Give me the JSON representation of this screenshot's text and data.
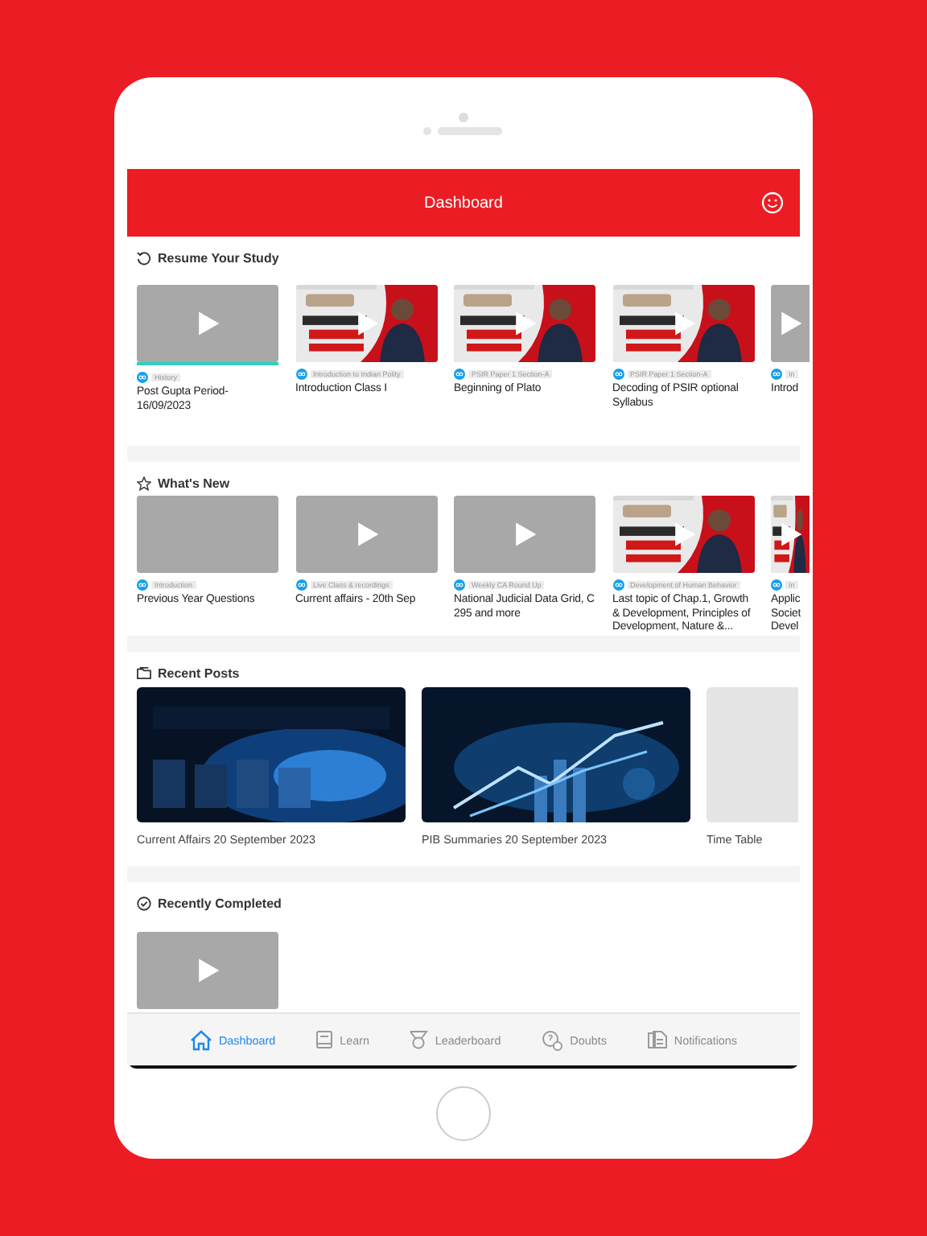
{
  "header": {
    "title": "Dashboard"
  },
  "resume": {
    "title": "Resume Your Study",
    "items": [
      {
        "kind": "video",
        "tag": "History",
        "title": "Post Gupta Period-16/09/2023",
        "level": 1
      },
      {
        "kind": "picture",
        "tag": "Introduction to Indian Polity",
        "title": "Introduction Class I"
      },
      {
        "kind": "picture",
        "tag": "PSIR Paper 1 Section-A",
        "title": "Beginning of Plato"
      },
      {
        "kind": "picture",
        "tag": "PSIR Paper 1 Section-A",
        "title": "Decoding of PSIR optional Syllabus"
      },
      {
        "kind": "video",
        "tag": "In",
        "title": "Introd",
        "partial": true
      }
    ]
  },
  "whats_new": {
    "title": "What's New",
    "items": [
      {
        "kind": "blank",
        "tag": "Introduction",
        "title": "Previous Year Questions"
      },
      {
        "kind": "video",
        "tag": "Live Class & recordings",
        "title": "Current affairs - 20th Sep"
      },
      {
        "kind": "video",
        "tag": "Weekly CA Round Up",
        "title": "National Judicial Data Grid, C 295 and more"
      },
      {
        "kind": "picture",
        "tag": "Development of Human Behavior",
        "title": "Last topic of Chap.1, Growth & Development, Principles of Development, Nature &..."
      },
      {
        "kind": "picture",
        "tag": "In",
        "title": "Applic Societ Devel",
        "partial": true
      }
    ]
  },
  "recent_posts": {
    "title": "Recent Posts",
    "items": [
      {
        "kind": "picture",
        "title": "Current Affairs 20 September 2023"
      },
      {
        "kind": "picture",
        "title": "PIB Summaries 20 September 2023"
      },
      {
        "kind": "blank",
        "title": "Time Table"
      }
    ]
  },
  "recently_completed": {
    "title": "Recently Completed",
    "items": [
      {
        "kind": "video"
      }
    ]
  },
  "nav": [
    {
      "label": "Dashboard",
      "selected": true
    },
    {
      "label": "Learn",
      "selected": false
    },
    {
      "label": "Leaderboard",
      "selected": false
    },
    {
      "label": "Doubts",
      "selected": false
    },
    {
      "label": "Notifications",
      "selected": false
    }
  ]
}
